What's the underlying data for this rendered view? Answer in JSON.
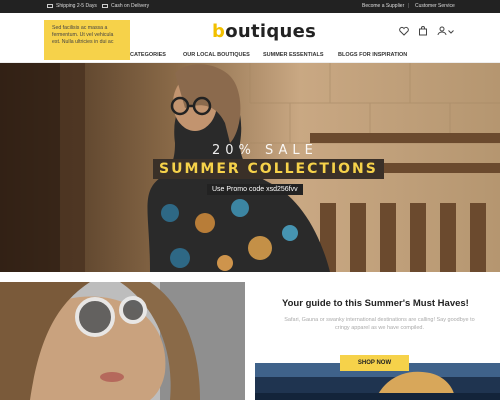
{
  "topbar": {
    "shipping": "Shipping 2-5 Days",
    "cod": "Cash on Delivery",
    "supplier": "Become a Supplier",
    "separator": "|",
    "customer": "Customer Service"
  },
  "header": {
    "logo_initial": "b",
    "logo_rest": "outiques",
    "icons": [
      "heart-icon",
      "bag-icon",
      "user-icon",
      "chevron-down-icon"
    ]
  },
  "nav": {
    "items": [
      "CATEGORIES",
      "OUR LOCAL BOUTIQUES",
      "SUMMER ESSENTIALS",
      "BLOGS FOR INSPIRATION"
    ]
  },
  "tooltip": {
    "text": "Sed facilisis ac massa a fermentum. Ut vel vehicula est. Nulla ultricies in dui ac"
  },
  "hero": {
    "sale": "20% SALE",
    "collections": "SUMMER COLLECTIONS",
    "promo": "Use Promo code xsd256fvv"
  },
  "guide": {
    "title": "Your guide to this Summer's Must Haves!",
    "desc": "Safari, Gauna or swanky international destinations are calling! Say goodbye to cringy apparel as we have compiled.",
    "cta": "SHOP NOW"
  },
  "colors": {
    "accent": "#f6d24a",
    "topbar_bg": "#222222",
    "logo_b": "#f2c000"
  }
}
